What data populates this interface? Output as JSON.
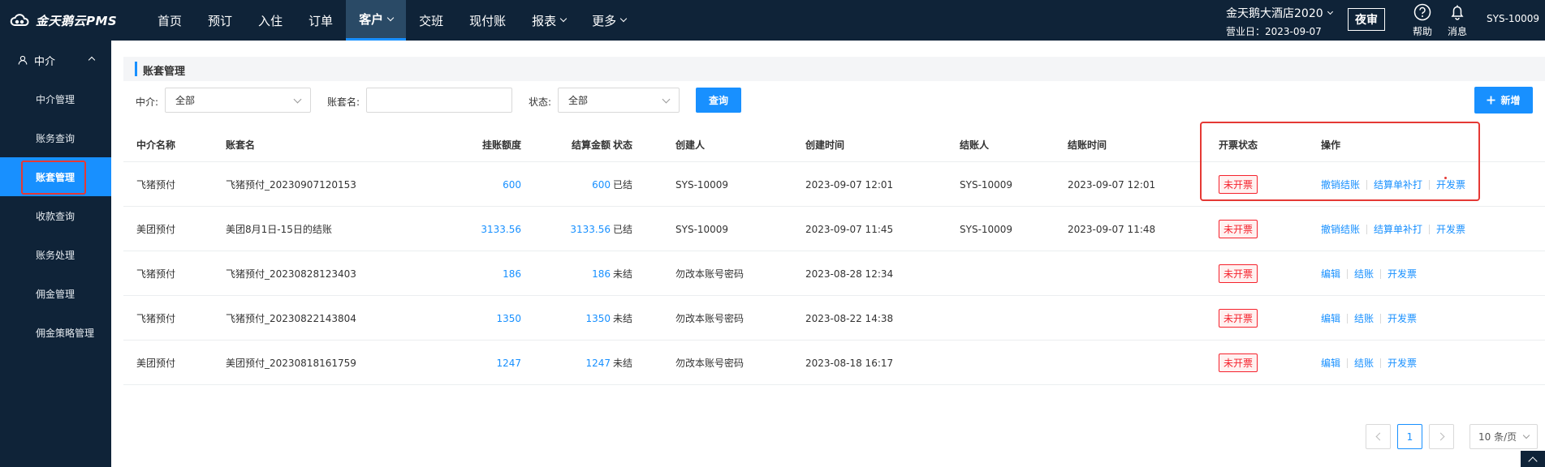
{
  "app": {
    "logo_text": "金天鹅云PMS"
  },
  "nav": [
    {
      "label": "首页",
      "dropdown": false,
      "active": false
    },
    {
      "label": "预订",
      "dropdown": false,
      "active": false
    },
    {
      "label": "入住",
      "dropdown": false,
      "active": false
    },
    {
      "label": "订单",
      "dropdown": false,
      "active": false
    },
    {
      "label": "客户",
      "dropdown": true,
      "active": true
    },
    {
      "label": "交班",
      "dropdown": false,
      "active": false
    },
    {
      "label": "现付账",
      "dropdown": false,
      "active": false
    },
    {
      "label": "报表",
      "dropdown": true,
      "active": false
    },
    {
      "label": "更多",
      "dropdown": true,
      "active": false
    }
  ],
  "header": {
    "hotel_name": "金天鹅大酒店2020",
    "business_day": "营业日：2023-09-07",
    "night_audit": "夜审",
    "help_label": "帮助",
    "message_label": "消息",
    "user": "SYS-10009"
  },
  "sidebar": {
    "group": "中介",
    "items": [
      {
        "label": "中介管理",
        "active": false
      },
      {
        "label": "账务查询",
        "active": false
      },
      {
        "label": "账套管理",
        "active": true
      },
      {
        "label": "收款查询",
        "active": false
      },
      {
        "label": "账务处理",
        "active": false
      },
      {
        "label": "佣金管理",
        "active": false
      },
      {
        "label": "佣金策略管理",
        "active": false
      }
    ]
  },
  "page": {
    "title": "账套管理"
  },
  "filters": {
    "agent_label": "中介:",
    "agent_value": "全部",
    "account_name_label": "账套名:",
    "account_name_value": "",
    "status_label": "状态:",
    "status_value": "全部",
    "query_button": "查询",
    "add_button": "新增"
  },
  "table": {
    "headers": [
      "中介名称",
      "账套名",
      "挂账额度",
      "结算金额",
      "状态",
      "创建人",
      "创建时间",
      "结账人",
      "结账时间",
      "开票状态",
      "操作"
    ],
    "rows": [
      {
        "agent": "飞猪预付",
        "name": "飞猪预付_20230907120153",
        "credit": "600",
        "settled": "600",
        "status": "已结",
        "creator": "SYS-10009",
        "created": "2023-09-07 12:01",
        "closer": "SYS-10009",
        "closed": "2023-09-07 12:01",
        "invoice": "未开票",
        "actions": [
          "撤销结账",
          "结算单补打",
          "开发票"
        ]
      },
      {
        "agent": "美团预付",
        "name": "美团8月1日-15日的结账",
        "credit": "3133.56",
        "settled": "3133.56",
        "status": "已结",
        "creator": "SYS-10009",
        "created": "2023-09-07 11:45",
        "closer": "SYS-10009",
        "closed": "2023-09-07 11:48",
        "invoice": "未开票",
        "actions": [
          "撤销结账",
          "结算单补打",
          "开发票"
        ]
      },
      {
        "agent": "飞猪预付",
        "name": "飞猪预付_20230828123403",
        "credit": "186",
        "settled": "186",
        "status": "未结",
        "creator": "勿改本账号密码",
        "created": "2023-08-28 12:34",
        "closer": "",
        "closed": "",
        "invoice": "未开票",
        "actions": [
          "编辑",
          "结账",
          "开发票"
        ]
      },
      {
        "agent": "飞猪预付",
        "name": "飞猪预付_20230822143804",
        "credit": "1350",
        "settled": "1350",
        "status": "未结",
        "creator": "勿改本账号密码",
        "created": "2023-08-22 14:38",
        "closer": "",
        "closed": "",
        "invoice": "未开票",
        "actions": [
          "编辑",
          "结账",
          "开发票"
        ]
      },
      {
        "agent": "美团预付",
        "name": "美团预付_20230818161759",
        "credit": "1247",
        "settled": "1247",
        "status": "未结",
        "creator": "勿改本账号密码",
        "created": "2023-08-18 16:17",
        "closer": "",
        "closed": "",
        "invoice": "未开票",
        "actions": [
          "编辑",
          "结账",
          "开发票"
        ]
      }
    ]
  },
  "pagination": {
    "current_page": "1",
    "page_size": "10 条/页"
  },
  "colors": {
    "primary": "#1890ff",
    "header_bg": "#0f2338",
    "highlight": "#e53935",
    "invoice_red": "#f5222d"
  },
  "icons": [
    "cloud-logo-icon",
    "user-icon",
    "help-icon",
    "bell-icon",
    "plus-icon",
    "chevron-down-icon",
    "chevron-up-icon",
    "prev-page-icon",
    "next-page-icon",
    "back-to-top-icon"
  ]
}
